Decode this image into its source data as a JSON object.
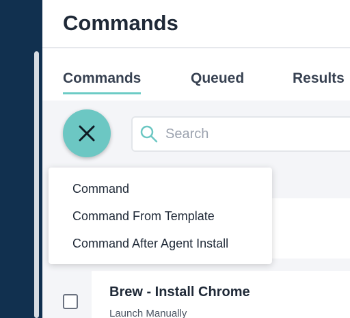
{
  "header": {
    "title": "Commands"
  },
  "tabs": [
    {
      "label": "Commands",
      "active": true
    },
    {
      "label": "Queued",
      "active": false
    },
    {
      "label": "Results",
      "active": false
    }
  ],
  "toolbar": {
    "fab_icon": "close-icon",
    "search": {
      "placeholder": "Search",
      "value": "",
      "icon": "search-icon"
    }
  },
  "menu": {
    "items": [
      {
        "label": "Command"
      },
      {
        "label": "Command From Template"
      },
      {
        "label": "Command After Agent Install"
      }
    ]
  },
  "list": {
    "rows": [
      {
        "title": "Brew - Install Chrome",
        "subtitle": "Launch Manually",
        "checked": false
      }
    ]
  },
  "colors": {
    "sidebar": "#11304f",
    "accent": "#6cc7c3",
    "text": "#1f2937"
  }
}
